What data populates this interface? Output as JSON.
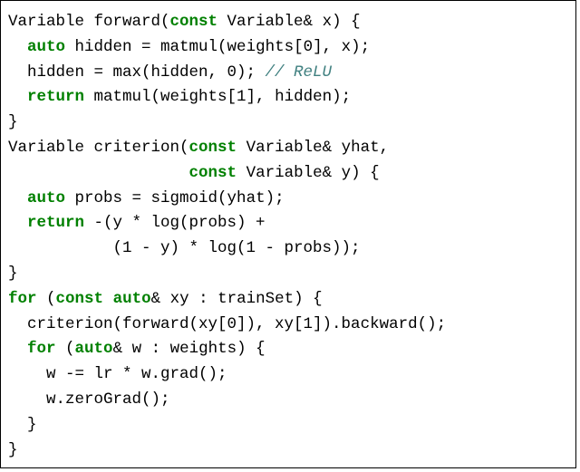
{
  "code": {
    "tokens": [
      {
        "t": "Variable forward("
      },
      {
        "t": "const",
        "c": "kw"
      },
      {
        "t": " Variable& x) {\n"
      },
      {
        "t": "  "
      },
      {
        "t": "auto",
        "c": "kw"
      },
      {
        "t": " hidden = matmul(weights[0], x);\n"
      },
      {
        "t": "  hidden = max(hidden, 0); "
      },
      {
        "t": "// ReLU",
        "c": "cm"
      },
      {
        "t": "\n"
      },
      {
        "t": "  "
      },
      {
        "t": "return",
        "c": "kw"
      },
      {
        "t": " matmul(weights[1], hidden);\n"
      },
      {
        "t": "}\n"
      },
      {
        "t": "Variable criterion("
      },
      {
        "t": "const",
        "c": "kw"
      },
      {
        "t": " Variable& yhat,\n"
      },
      {
        "t": "                   "
      },
      {
        "t": "const",
        "c": "kw"
      },
      {
        "t": " Variable& y) {\n"
      },
      {
        "t": "  "
      },
      {
        "t": "auto",
        "c": "kw"
      },
      {
        "t": " probs = sigmoid(yhat);\n"
      },
      {
        "t": "  "
      },
      {
        "t": "return",
        "c": "kw"
      },
      {
        "t": " -(y * log(probs) +\n"
      },
      {
        "t": "           (1 - y) * log(1 - probs));\n"
      },
      {
        "t": "}\n"
      },
      {
        "t": "for",
        "c": "kw"
      },
      {
        "t": " ("
      },
      {
        "t": "const",
        "c": "kw"
      },
      {
        "t": " "
      },
      {
        "t": "auto",
        "c": "kw"
      },
      {
        "t": "& xy : trainSet) {\n"
      },
      {
        "t": "  criterion(forward(xy[0]), xy[1]).backward();\n"
      },
      {
        "t": "  "
      },
      {
        "t": "for",
        "c": "kw"
      },
      {
        "t": " ("
      },
      {
        "t": "auto",
        "c": "kw"
      },
      {
        "t": "& w : weights) {\n"
      },
      {
        "t": "    w -= lr * w.grad();\n"
      },
      {
        "t": "    w.zeroGrad();\n"
      },
      {
        "t": "  }\n"
      },
      {
        "t": "}"
      }
    ]
  }
}
